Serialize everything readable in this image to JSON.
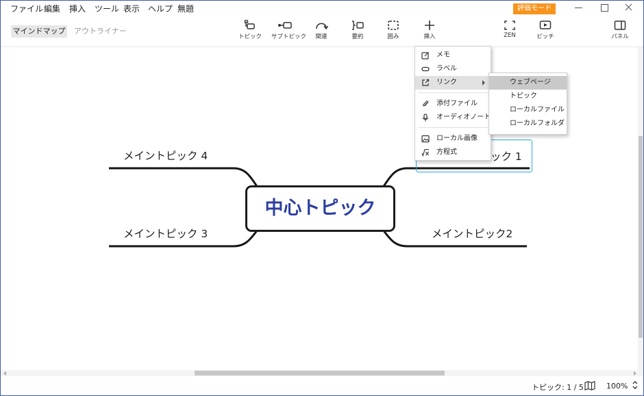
{
  "menubar": {
    "items": [
      "ファイル",
      "編集",
      "挿入",
      "ツール",
      "表示",
      "ヘルプ",
      "無題"
    ],
    "eval_badge": "評価モード"
  },
  "view_tabs": {
    "mindmap": "マインドマップ",
    "outliner": "アウトライナー"
  },
  "toolbar": {
    "topic": "トピック",
    "subtopic": "サブトピック",
    "relation": "関連",
    "summary": "要約",
    "boundary": "囲み",
    "insert": "挿入",
    "zen": "ZEN",
    "pitch": "ピッチ",
    "panel": "パネル"
  },
  "map": {
    "central": "中心トピック",
    "topic1": "メイントピック 1",
    "topic2": "メイントピック2",
    "topic3": "メイントピック 3",
    "topic4": "メイントピック 4",
    "topic1_visible": "ック 1"
  },
  "context_menu": {
    "memo": "メモ",
    "label": "ラベル",
    "link": "リンク",
    "attachment": "添付ファイル",
    "audio_note": "オーディオノート",
    "local_image": "ローカル画像",
    "equation": "方程式"
  },
  "link_submenu": {
    "webpage": "ウェブページ",
    "topic": "トピック",
    "local_file": "ローカルファイル",
    "local_folder": "ローカルフォルダ"
  },
  "statusbar": {
    "topic_count": "トピック: 1 / 5",
    "zoom": "100%"
  },
  "colors": {
    "accent_blue": "#2d3fa0",
    "selection_cyan": "#2aa9e0",
    "eval_orange": "#f7941d",
    "window_border": "#3d5aa8"
  }
}
